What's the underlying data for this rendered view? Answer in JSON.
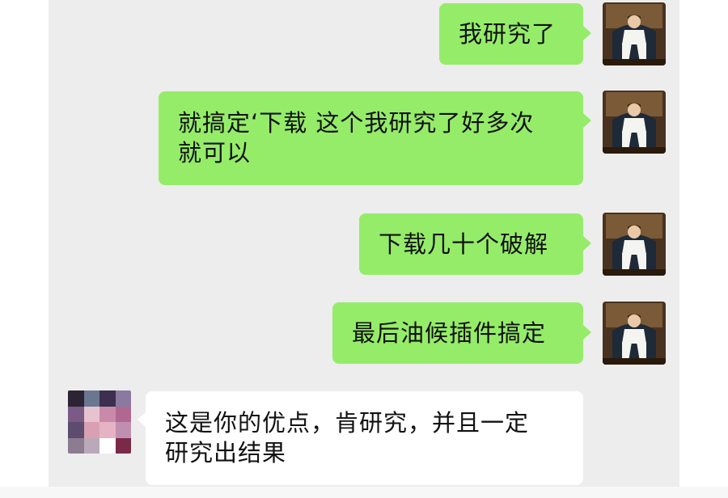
{
  "messages": [
    {
      "side": "right",
      "text": "我研究了"
    },
    {
      "side": "right",
      "text": "就搞定‘下载 这个我研究了好多次\n就可以"
    },
    {
      "side": "right",
      "text": "下载几十个破解"
    },
    {
      "side": "right",
      "text": "最后油候插件搞定"
    },
    {
      "side": "left",
      "text": "这是你的优点，肯研究，并且一定\n研究出结果"
    }
  ],
  "colors": {
    "chat_background": "#ededed",
    "outgoing_bubble": "#95ec69",
    "incoming_bubble": "#ffffff"
  },
  "avatars": {
    "self": "person-in-white-suit-photo",
    "other": "pixelated-avatar",
    "other_mosaic": [
      "#2c2433",
      "#6b7790",
      "#3c2f50",
      "#8a7aa0",
      "#7a5a86",
      "#e7c3d0",
      "#c88aa8",
      "#b06890",
      "#5e4c6e",
      "#d9a0b4",
      "#e6b3c4",
      "#c08fb0",
      "#8c7c90",
      "#b9a9b9",
      "#ffffff",
      "#7a2a48"
    ]
  }
}
